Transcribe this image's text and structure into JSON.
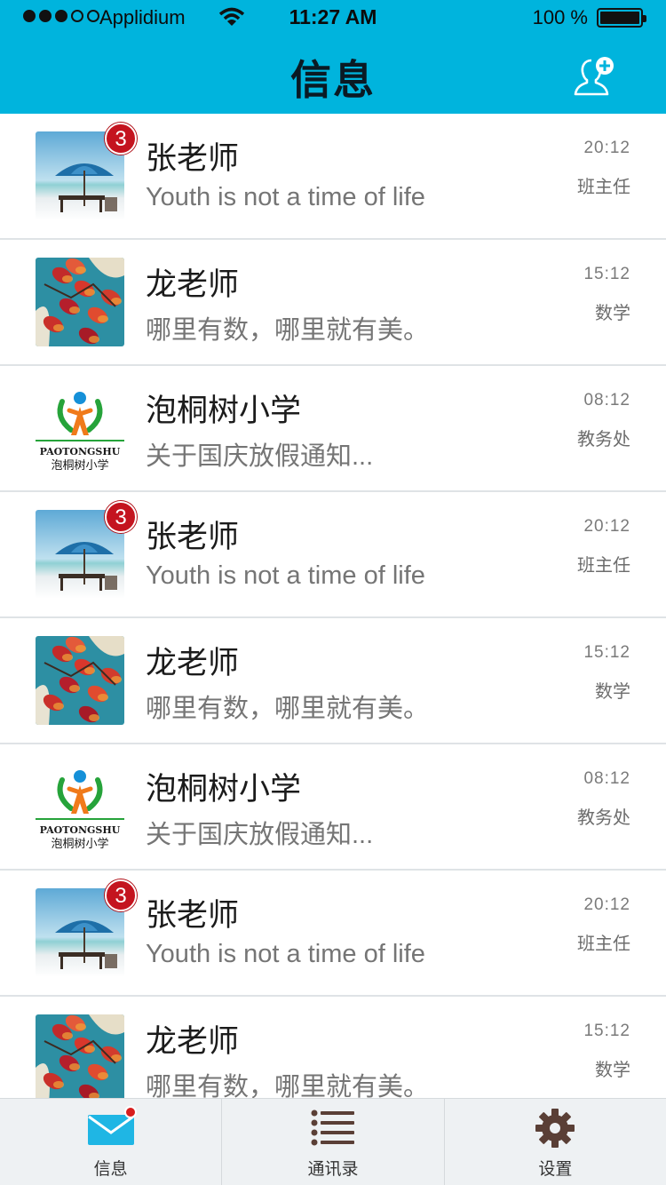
{
  "status_bar": {
    "carrier": "Applidium",
    "time": "11:27 AM",
    "battery": "100 %"
  },
  "header": {
    "title": "信息",
    "action_icon": "add-contact-icon"
  },
  "messages": [
    {
      "name": "张老师",
      "preview": "Youth is not a time of life",
      "time": "20:12",
      "tag": "班主任",
      "badge": "3",
      "avatar": "beach-umbrella-photo"
    },
    {
      "name": "龙老师",
      "preview": "哪里有数，哪里就有美。",
      "time": "15:12",
      "tag": "数学",
      "badge": "",
      "avatar": "red-flowers-photo"
    },
    {
      "name": "泡桐树小学",
      "preview": "关于国庆放假通知...",
      "time": "08:12",
      "tag": "教务处",
      "badge": "",
      "avatar": "school-logo",
      "logo_text": "PAOTONGSHU",
      "logo_cn": "泡桐树小学"
    },
    {
      "name": "张老师",
      "preview": "Youth is not a time of life",
      "time": "20:12",
      "tag": "班主任",
      "badge": "3",
      "avatar": "beach-umbrella-photo"
    },
    {
      "name": "龙老师",
      "preview": "哪里有数，哪里就有美。",
      "time": "15:12",
      "tag": "数学",
      "badge": "",
      "avatar": "red-flowers-photo"
    },
    {
      "name": "泡桐树小学",
      "preview": "关于国庆放假通知...",
      "time": "08:12",
      "tag": "教务处",
      "badge": "",
      "avatar": "school-logo",
      "logo_text": "PAOTONGSHU",
      "logo_cn": "泡桐树小学"
    },
    {
      "name": "张老师",
      "preview": "Youth is not a time of life",
      "time": "20:12",
      "tag": "班主任",
      "badge": "3",
      "avatar": "beach-umbrella-photo"
    },
    {
      "name": "龙老师",
      "preview": "哪里有数，哪里就有美。",
      "time": "15:12",
      "tag": "数学",
      "badge": "",
      "avatar": "red-flowers-photo"
    }
  ],
  "tabbar": {
    "tabs": [
      {
        "label": "信息",
        "icon": "envelope-icon",
        "active": true,
        "has_dot": true
      },
      {
        "label": "通讯录",
        "icon": "list-icon",
        "active": false,
        "has_dot": false
      },
      {
        "label": "设置",
        "icon": "gear-icon",
        "active": false,
        "has_dot": false
      }
    ]
  },
  "colors": {
    "header_bg": "#00b4dd",
    "badge": "#c4141f",
    "tab_active_icon": "#1fb6e4",
    "tab_icon": "#5a3f36"
  }
}
